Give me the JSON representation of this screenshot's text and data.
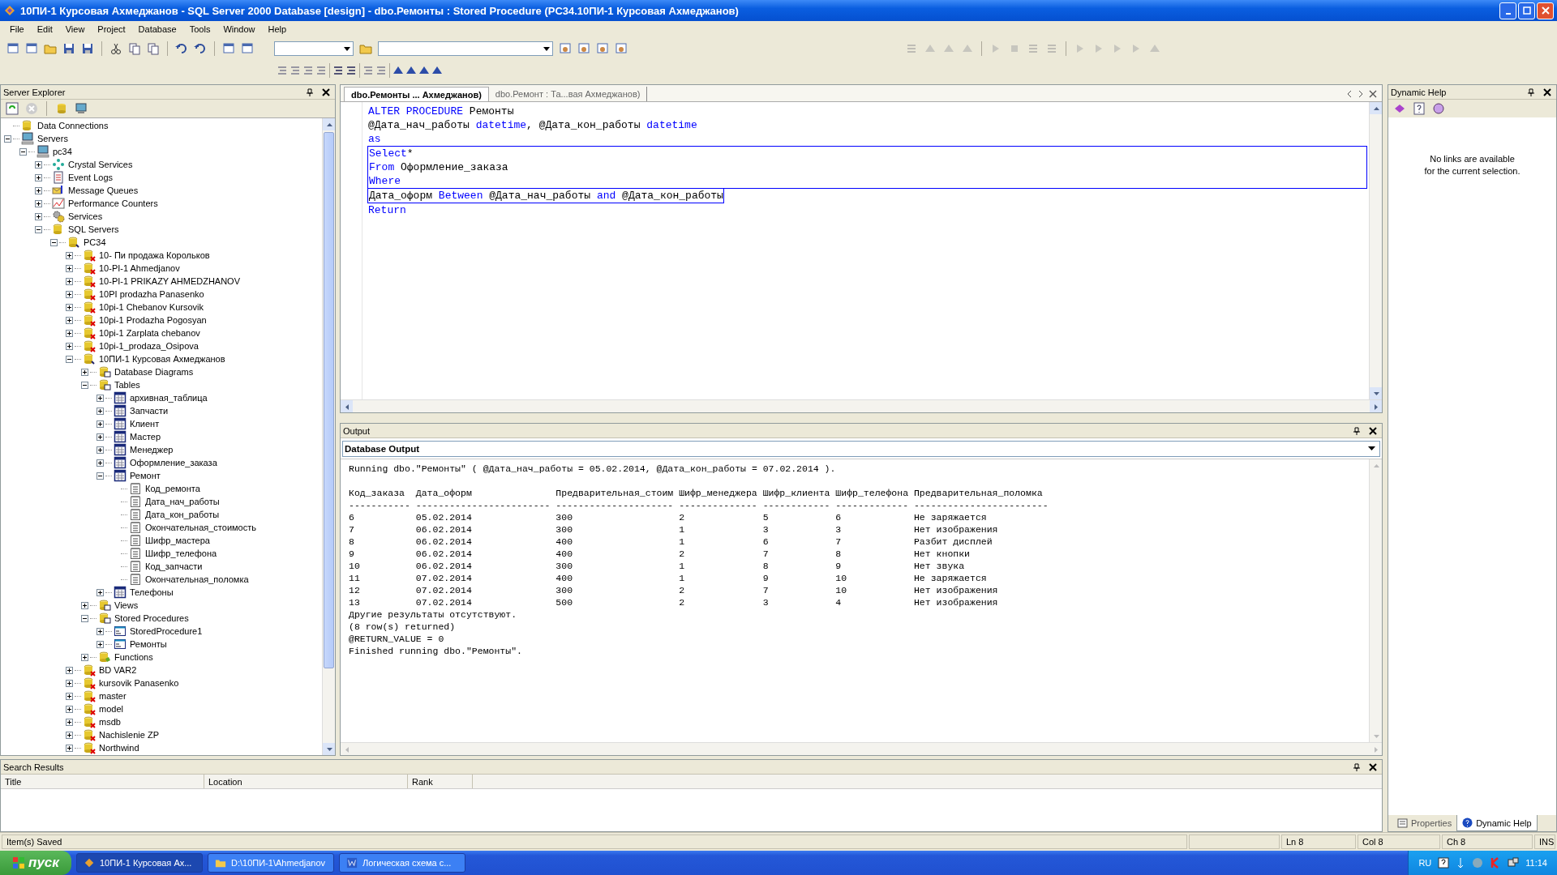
{
  "window": {
    "title": "10ПИ-1 Курсовая Ахмеджанов - SQL Server 2000 Database [design] - dbo.Ремонты : Stored Procedure (PC34.10ПИ-1 Курсовая Ахмеджанов)"
  },
  "menu": [
    "File",
    "Edit",
    "View",
    "Project",
    "Database",
    "Tools",
    "Window",
    "Help"
  ],
  "server_explorer": {
    "title": "Server Explorer",
    "tree": [
      {
        "label": "Data Connections",
        "kind": "connections"
      },
      {
        "label": "Servers",
        "kind": "computer",
        "expanded": true,
        "children": [
          {
            "label": "pc34",
            "kind": "computer",
            "expanded": true,
            "children": [
              {
                "label": "Crystal Services",
                "kind": "crystal",
                "expanded": false
              },
              {
                "label": "Event Logs",
                "kind": "eventlog",
                "expanded": false
              },
              {
                "label": "Message Queues",
                "kind": "queue",
                "expanded": false
              },
              {
                "label": "Performance Counters",
                "kind": "perf",
                "expanded": false
              },
              {
                "label": "Services",
                "kind": "services",
                "expanded": false
              },
              {
                "label": "SQL Servers",
                "kind": "db",
                "expanded": true,
                "children": [
                  {
                    "label": "PC34",
                    "kind": "sqlserver",
                    "expanded": true,
                    "children": [
                      {
                        "label": "10- Пи продажа Корольков",
                        "kind": "db_offline",
                        "expanded": false
                      },
                      {
                        "label": "10-PI-1 Ahmedjanov",
                        "kind": "db_offline",
                        "expanded": false
                      },
                      {
                        "label": "10-PI-1 PRIKAZY AHMEDZHANOV",
                        "kind": "db_offline",
                        "expanded": false
                      },
                      {
                        "label": "10PI prodazha Panasenko",
                        "kind": "db_offline",
                        "expanded": false
                      },
                      {
                        "label": "10pi-1 Chebanov Kursovik",
                        "kind": "db_offline",
                        "expanded": false
                      },
                      {
                        "label": "10pi-1 Prodazha Pogosyan",
                        "kind": "db_offline",
                        "expanded": false
                      },
                      {
                        "label": "10pi-1 Zarplata chebanov",
                        "kind": "db_offline",
                        "expanded": false
                      },
                      {
                        "label": "10pi-1_prodaza_Osipova",
                        "kind": "db_offline",
                        "expanded": false
                      },
                      {
                        "label": "10ПИ-1 Курсовая Ахмеджанов",
                        "kind": "sqlserver",
                        "expanded": true,
                        "children": [
                          {
                            "label": "Database Diagrams",
                            "kind": "diagrams",
                            "expanded": false
                          },
                          {
                            "label": "Tables",
                            "kind": "tables",
                            "expanded": true,
                            "children": [
                              {
                                "label": "архивная_таблица",
                                "kind": "table",
                                "expanded": false
                              },
                              {
                                "label": "Запчасти",
                                "kind": "table",
                                "expanded": false
                              },
                              {
                                "label": "Клиент",
                                "kind": "table",
                                "expanded": false
                              },
                              {
                                "label": "Мастер",
                                "kind": "table",
                                "expanded": false
                              },
                              {
                                "label": "Менеджер",
                                "kind": "table",
                                "expanded": false
                              },
                              {
                                "label": "Оформление_заказа",
                                "kind": "table",
                                "expanded": false
                              },
                              {
                                "label": "Ремонт",
                                "kind": "table",
                                "expanded": true,
                                "children": [
                                  {
                                    "label": "Код_ремонта",
                                    "kind": "column"
                                  },
                                  {
                                    "label": "Дата_нач_работы",
                                    "kind": "column"
                                  },
                                  {
                                    "label": "Дата_кон_работы",
                                    "kind": "column"
                                  },
                                  {
                                    "label": "Окончательная_стоимость",
                                    "kind": "column"
                                  },
                                  {
                                    "label": "Шифр_мастера",
                                    "kind": "column"
                                  },
                                  {
                                    "label": "Шифр_телефона",
                                    "kind": "column"
                                  },
                                  {
                                    "label": "Код_запчасти",
                                    "kind": "column"
                                  },
                                  {
                                    "label": "Окончательная_поломка",
                                    "kind": "column"
                                  }
                                ]
                              },
                              {
                                "label": "Телефоны",
                                "kind": "table",
                                "expanded": false
                              }
                            ]
                          },
                          {
                            "label": "Views",
                            "kind": "tables",
                            "expanded": false
                          },
                          {
                            "label": "Stored Procedures",
                            "kind": "tables",
                            "expanded": true,
                            "children": [
                              {
                                "label": "StoredProcedure1",
                                "kind": "proc",
                                "expanded": false
                              },
                              {
                                "label": "Ремонты",
                                "kind": "proc",
                                "expanded": false
                              }
                            ]
                          },
                          {
                            "label": "Functions",
                            "kind": "functions",
                            "expanded": false
                          }
                        ]
                      },
                      {
                        "label": "BD VAR2",
                        "kind": "db_offline",
                        "expanded": false
                      },
                      {
                        "label": "kursovik Panasenko",
                        "kind": "db_offline",
                        "expanded": false
                      },
                      {
                        "label": "master",
                        "kind": "db_offline",
                        "expanded": false
                      },
                      {
                        "label": "model",
                        "kind": "db_offline",
                        "expanded": false
                      },
                      {
                        "label": "msdb",
                        "kind": "db_offline",
                        "expanded": false
                      },
                      {
                        "label": "Nachislenie ZP",
                        "kind": "db_offline",
                        "expanded": false
                      },
                      {
                        "label": "Northwind",
                        "kind": "db_offline",
                        "expanded": false
                      }
                    ]
                  }
                ]
              }
            ]
          }
        ]
      }
    ]
  },
  "editor": {
    "tabs": [
      {
        "label": "dbo.Ремонты ... Ахмеджанов)",
        "selected": true
      },
      {
        "label": "dbo.Ремонт : Та...вая Ахмеджанов)",
        "selected": false
      }
    ],
    "lines": [
      {
        "in_block": false,
        "tokens": [
          {
            "text": "ALTER PROCEDURE",
            "kind": "keyword"
          },
          {
            "text": " Ремонты",
            "kind": "plain"
          }
        ]
      },
      {
        "in_block": false,
        "tokens": [
          {
            "text": "@Дата_нач_работы ",
            "kind": "plain"
          },
          {
            "text": "datetime",
            "kind": "keyword"
          },
          {
            "text": ", @Дата_кон_работы ",
            "kind": "plain"
          },
          {
            "text": "datetime",
            "kind": "keyword"
          }
        ]
      },
      {
        "in_block": false,
        "tokens": [
          {
            "text": "as",
            "kind": "keyword"
          }
        ]
      },
      {
        "in_block": true,
        "tokens": [
          {
            "text": "Select",
            "kind": "keyword"
          },
          {
            "text": "*",
            "kind": "plain"
          }
        ]
      },
      {
        "in_block": true,
        "tokens": [
          {
            "text": "From",
            "kind": "keyword"
          },
          {
            "text": " Оформление_заказа",
            "kind": "plain"
          }
        ]
      },
      {
        "in_block": true,
        "tokens": [
          {
            "text": "Where",
            "kind": "keyword"
          }
        ]
      },
      {
        "in_block": true,
        "tokens": [
          {
            "text": "Дата_оформ ",
            "kind": "plain"
          },
          {
            "text": "Between",
            "kind": "keyword"
          },
          {
            "text": " @Дата_нач_работы ",
            "kind": "plain"
          },
          {
            "text": "and",
            "kind": "keyword"
          },
          {
            "text": " @Дата_кон_работы",
            "kind": "plain"
          }
        ]
      },
      {
        "in_block": false,
        "tokens": [
          {
            "text": "Return",
            "kind": "keyword"
          }
        ]
      }
    ]
  },
  "output": {
    "title": "Output",
    "pane": "Database Output",
    "running_line": "Running dbo.\"Ремонты\" ( @Дата_нач_работы = 05.02.2014, @Дата_кон_работы = 07.02.2014 ).",
    "columns": [
      "Код_заказа",
      "Дата_оформ",
      "Предварительная_стоим",
      "Шифр_менеджера",
      "Шифр_клиента",
      "Шифр_телефона",
      "Предварительная_поломка"
    ],
    "separators": [
      "-----------",
      "------------------------",
      "---------------------",
      "--------------",
      "------------",
      "-------------",
      "------------------------"
    ],
    "rows": [
      [
        "6",
        "05.02.2014",
        "300",
        "2",
        "5",
        "6",
        "Не заряжается"
      ],
      [
        "7",
        "06.02.2014",
        "300",
        "1",
        "3",
        "3",
        "Нет изображения"
      ],
      [
        "8",
        "06.02.2014",
        "400",
        "1",
        "6",
        "7",
        "Разбит дисплей"
      ],
      [
        "9",
        "06.02.2014",
        "400",
        "2",
        "7",
        "8",
        "Нет кнопки"
      ],
      [
        "10",
        "06.02.2014",
        "300",
        "1",
        "8",
        "9",
        "Нет звука"
      ],
      [
        "11",
        "07.02.2014",
        "400",
        "1",
        "9",
        "10",
        "Не заряжается"
      ],
      [
        "12",
        "07.02.2014",
        "300",
        "2",
        "7",
        "10",
        "Нет изображения"
      ],
      [
        "13",
        "07.02.2014",
        "500",
        "2",
        "3",
        "4",
        "Нет изображения"
      ]
    ],
    "footer_lines": [
      "Другие результаты отсутствуют.",
      "(8 row(s) returned)",
      "@RETURN_VALUE = 0",
      "Finished running dbo.\"Ремонты\"."
    ]
  },
  "dynamic_help": {
    "title": "Dynamic Help",
    "message_lines": [
      "No links are available",
      "for the current selection."
    ],
    "tabs": [
      {
        "label": "Properties",
        "selected": false
      },
      {
        "label": "Dynamic Help",
        "selected": true
      }
    ]
  },
  "search_results": {
    "title": "Search Results",
    "columns": [
      "Title",
      "Location",
      "Rank"
    ]
  },
  "status_bar": {
    "message": "Item(s) Saved",
    "ln": "Ln 8",
    "col": "Col 8",
    "ch": "Ch 8",
    "mode": "INS"
  },
  "taskbar": {
    "start": "пуск",
    "items": [
      {
        "label": "10ПИ-1 Курсовая Ах...",
        "selected": true
      },
      {
        "label": "D:\\10ПИ-1\\Ahmedjanov",
        "selected": false
      },
      {
        "label": "Логическая схема с...",
        "selected": false
      }
    ],
    "language": "RU",
    "time": "11:14"
  }
}
